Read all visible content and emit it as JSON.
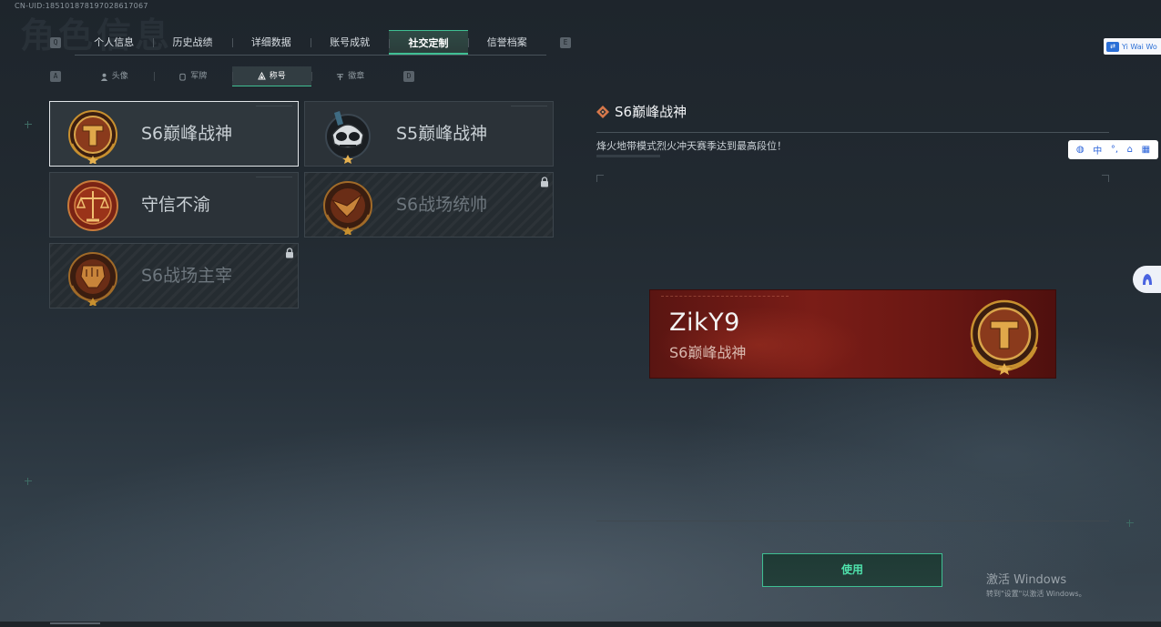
{
  "uid_text": "CN-UID:185101878197028617067",
  "bg_title": "角色信息",
  "main_tabs": [
    {
      "label": "个人信息"
    },
    {
      "label": "历史战绩"
    },
    {
      "label": "详细数据"
    },
    {
      "label": "账号成就"
    },
    {
      "label": "社交定制",
      "active": true
    },
    {
      "label": "信誉档案"
    }
  ],
  "key_hints": {
    "prev_main": "Q",
    "next_main": "E",
    "prev_sub": "A",
    "next_sub": "D"
  },
  "sub_tabs": [
    {
      "label": "头像",
      "icon": "person-icon"
    },
    {
      "label": "军牌",
      "icon": "dogtag-icon"
    },
    {
      "label": "称号",
      "icon": "title-icon",
      "active": true
    },
    {
      "label": "徽章",
      "icon": "emblem-icon"
    }
  ],
  "titles": [
    {
      "label": "S6巅峰战神",
      "badge": "hammer-badge-icon",
      "selected": true,
      "locked": false
    },
    {
      "label": "S5巅峰战神",
      "badge": "skull-badge-icon",
      "selected": false,
      "locked": false
    },
    {
      "label": "守信不渝",
      "badge": "scales-badge-icon",
      "selected": false,
      "locked": false
    },
    {
      "label": "S6战场统帅",
      "badge": "eagle-badge-icon",
      "selected": false,
      "locked": true
    },
    {
      "label": "S6战场主宰",
      "badge": "fist-badge-icon",
      "selected": false,
      "locked": true
    }
  ],
  "detail": {
    "title": "S6巅峰战神",
    "description": "烽火地带模式烈火冲天赛季达到最高段位！"
  },
  "preview": {
    "player_name": "ZikY9",
    "title": "S6巅峰战神"
  },
  "use_button": "使用",
  "activate_windows": {
    "line1": "激活 Windows",
    "line2": "转到\"设置\"以激活 Windows。"
  },
  "overlay": {
    "translate_label": "Yi Wai Wo",
    "ime_lang": "中",
    "ime_punct": "°,"
  },
  "colors": {
    "accent": "#3fbf93",
    "banner": "#7a1d17",
    "badge_gold": "#c8902f"
  }
}
